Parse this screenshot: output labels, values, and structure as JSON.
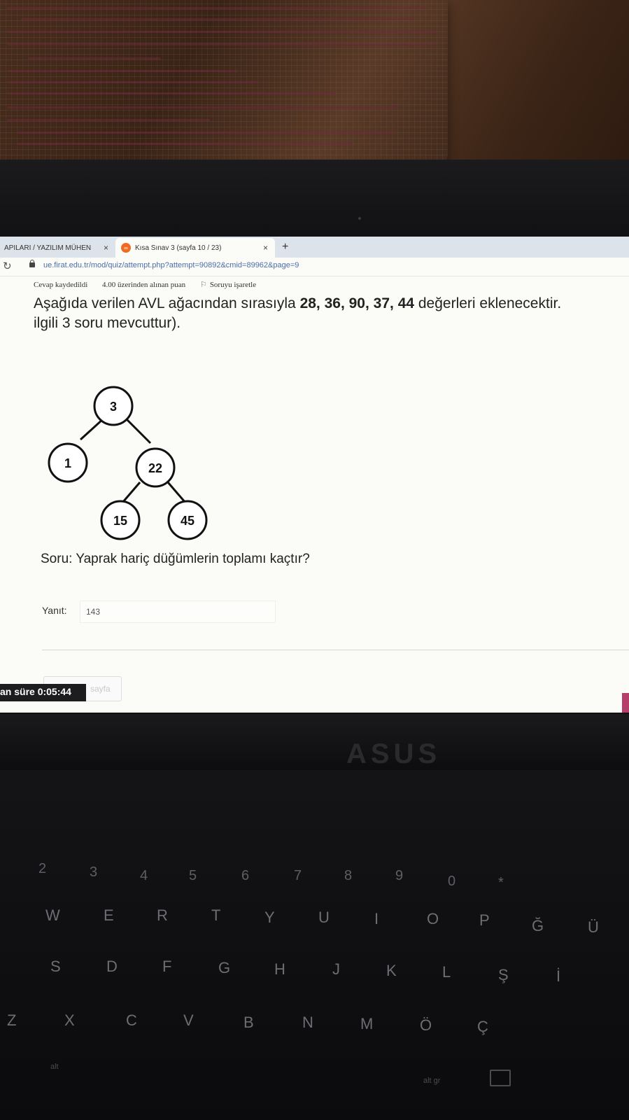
{
  "browser": {
    "tabs": [
      {
        "label": "APILARI / YAZILIM MÜHEN",
        "close": "×"
      },
      {
        "label": "Kısa Sınav 3 (sayfa 10 / 23)",
        "close": "×",
        "favicon": "moodle-icon"
      }
    ],
    "new_tab": "+",
    "url": "ue.firat.edu.tr/mod/quiz/attempt.php?attempt=90892&cmid=89962&page=9"
  },
  "quiz": {
    "status": "Cevap kaydedildi",
    "points": "4.00 üzerinden alınan puan",
    "flag_label": "Soruyu işaretle",
    "question_prefix": "Aşağıda verilen AVL ağacından sırasıyla ",
    "question_values": "28, 36, 90, 37, 44",
    "question_suffix": " değerleri eklenecektir.",
    "question_line2": "ilgili 3 soru mevcuttur).",
    "tree_nodes": [
      "3",
      "1",
      "22",
      "15",
      "45"
    ],
    "prompt": "Soru: Yaprak hariç düğümlerin toplamı kaçtır?",
    "answer_label": "Yanıt:",
    "answer_value": "143",
    "next_button": "sayfa",
    "timer": "an süre 0:05:44"
  },
  "keyboard": {
    "row_numbers": [
      "2",
      "3",
      "4",
      "5",
      "6",
      "7",
      "8",
      "9",
      "0",
      "*"
    ],
    "row_top": [
      "W",
      "E",
      "R",
      "T",
      "Y",
      "U",
      "I",
      "O",
      "P",
      "Ğ",
      "Ü"
    ],
    "row_home": [
      "S",
      "D",
      "F",
      "G",
      "H",
      "J",
      "K",
      "L",
      "Ş",
      "İ"
    ],
    "row_bottom": [
      "Z",
      "X",
      "C",
      "V",
      "B",
      "N",
      "M",
      "Ö",
      "Ç"
    ],
    "alt": "alt",
    "alt_gr": "alt gr"
  },
  "colors": {
    "accent": "#b53f6a",
    "favicon": "#f26a21",
    "url": "#4d6ea8"
  }
}
